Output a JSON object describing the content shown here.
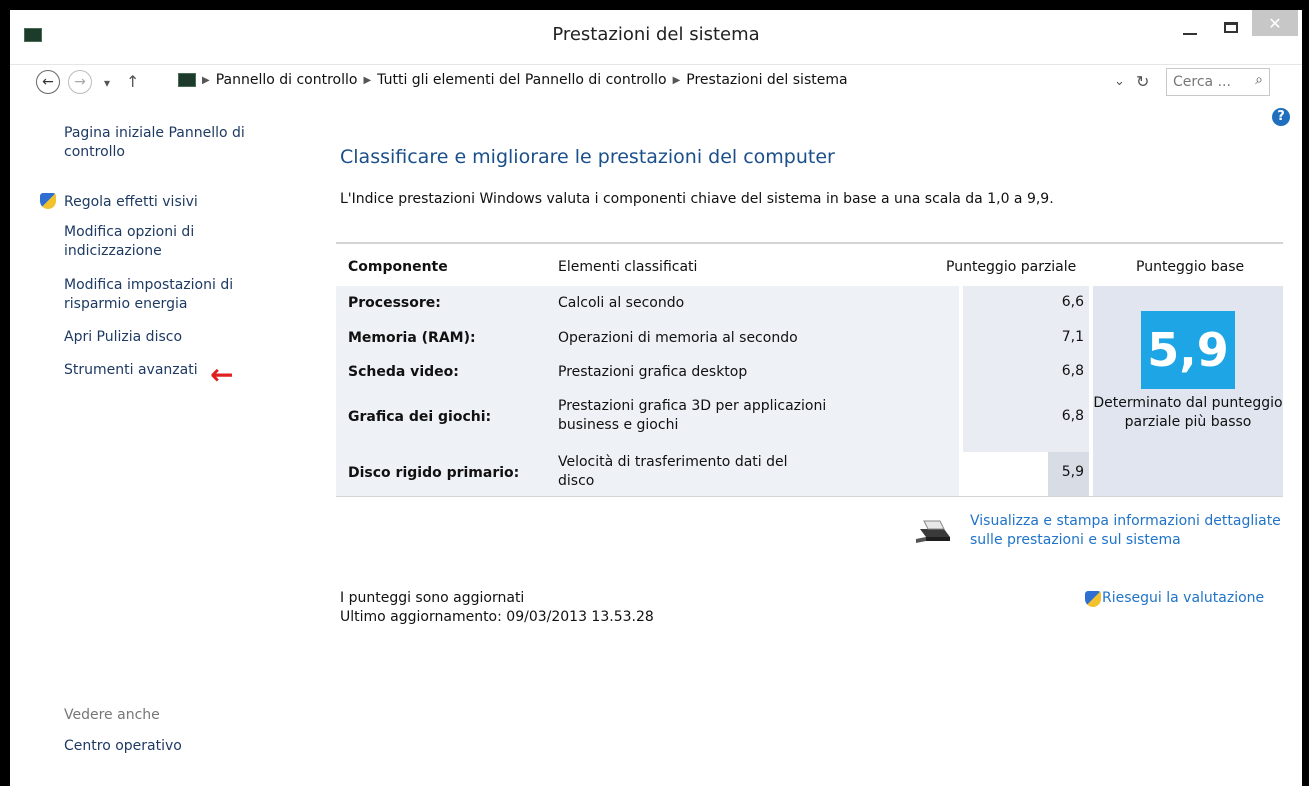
{
  "window": {
    "title": "Prestazioni del sistema",
    "close_glyph": "✕"
  },
  "address": {
    "crumbs": [
      "Pannello di controllo",
      "Tutti gli elementi del Pannello di controllo",
      "Prestazioni del sistema"
    ],
    "search_placeholder": "Cerca ..."
  },
  "sidebar": {
    "items": [
      "Pagina iniziale Pannello di controllo",
      "Regola effetti visivi",
      "Modifica opzioni di indicizzazione",
      "Modifica impostazioni di risparmio energia",
      "Apri Pulizia disco",
      "Strumenti avanzati"
    ],
    "see_also_label": "Vedere anche",
    "see_also_link": "Centro operativo"
  },
  "main": {
    "title": "Classificare e migliorare le prestazioni del computer",
    "subtitle": "L'Indice prestazioni Windows valuta i componenti chiave del sistema in base a una scala da 1,0 a 9,9.",
    "headers": {
      "component": "Componente",
      "rated": "Elementi classificati",
      "subscore": "Punteggio parziale",
      "base": "Punteggio base"
    },
    "rows": [
      {
        "component": "Processore:",
        "desc": "Calcoli al secondo",
        "score": "6,6"
      },
      {
        "component": "Memoria (RAM):",
        "desc": "Operazioni di memoria al secondo",
        "score": "7,1"
      },
      {
        "component": "Scheda video:",
        "desc": "Prestazioni grafica desktop",
        "score": "6,8"
      },
      {
        "component": "Grafica dei giochi:",
        "desc": "Prestazioni grafica 3D per applicazioni business e giochi",
        "score": "6,8"
      },
      {
        "component": "Disco rigido primario:",
        "desc": "Velocità di trasferimento dati del disco",
        "score": "5,9"
      }
    ],
    "base_score": "5,9",
    "base_note": "Determinato dal punteggio parziale più basso",
    "print_link": "Visualizza e stampa informazioni dettagliate sulle prestazioni e sul sistema",
    "status_line1": "I punteggi sono aggiornati",
    "status_line2": "Ultimo aggiornamento: 09/03/2013 13.53.28",
    "rerun_link": "Riesegui la valutazione"
  },
  "colors": {
    "accent": "#1f73c8",
    "tile": "#1ea5e6",
    "arrow": "#e02020"
  }
}
